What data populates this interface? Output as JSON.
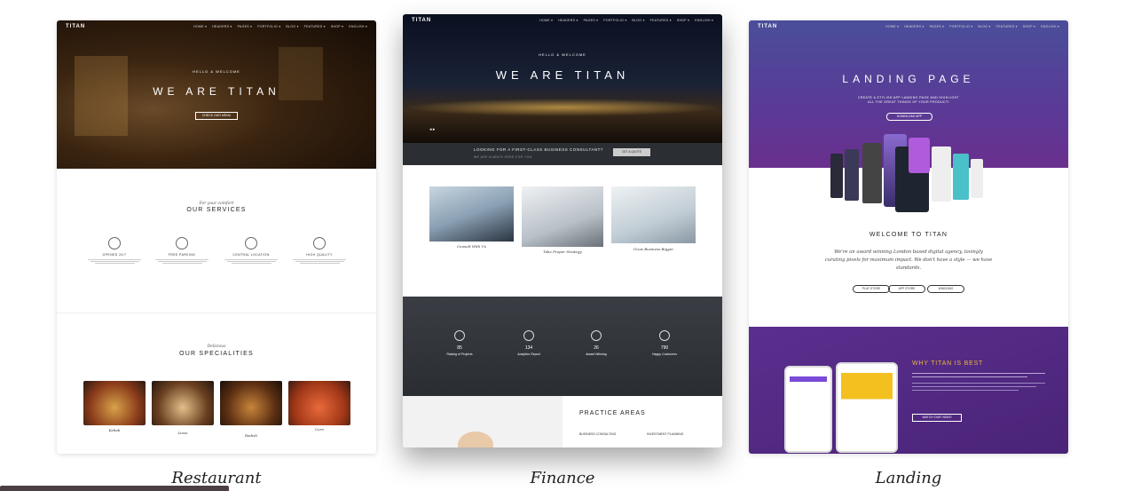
{
  "cards": [
    {
      "caption": "Restaurant",
      "logo": "TITAN",
      "nav": [
        "HOME ▾",
        "HEADERS ▾",
        "PAGES ▾",
        "PORTFOLIO ▾",
        "BLOG ▾",
        "FEATURES ▾",
        "SHOP ▾",
        "ENGLISH ▾"
      ],
      "hero_small": "HELLO & WELCOME",
      "hero_title": "WE ARE TITAN",
      "hero_button": "CHECK OUR MENU",
      "services_sub": "For your comfort",
      "services_title": "OUR SERVICES",
      "services": [
        "OPENED 24/7",
        "FREE PARKING",
        "CENTRAL LOCATION",
        "HIGH QUALITY"
      ],
      "specialities_sub": "Delicious",
      "specialities_title": "OUR SPECIALITIES",
      "dishes": [
        "Kebab",
        "Linos",
        "Radish",
        "Corn"
      ]
    },
    {
      "caption": "Finance",
      "logo": "TITAN",
      "nav": [
        "HOME ▾",
        "HEADERS ▾",
        "PAGES ▾",
        "PORTFOLIO ▾",
        "BLOG ▾",
        "FEATURES ▾",
        "SHOP ▾",
        "ENGLISH ▾"
      ],
      "hero_small": "HELLO & WELCOME",
      "hero_title": "WE ARE TITAN",
      "cta_text": "LOOKING FOR A FIRST-CLASS BUSINESS CONSULTANT?",
      "cta_sub": "WE ARE ALWAYS HERE FOR YOU",
      "cta_button": "GET A QUOTE",
      "features": [
        "Consult With Us",
        "Take Proper Strategy",
        "Grow Business Bigger"
      ],
      "stats": [
        {
          "value": "85",
          "label": "Raising of Projects"
        },
        {
          "value": "134",
          "label": "Analytics Report"
        },
        {
          "value": "26",
          "label": "Award Winning"
        },
        {
          "value": "790",
          "label": "Happy Customers"
        }
      ],
      "practice_title": "PRACTICE AREAS",
      "practice_items": [
        "BUSINESS CONSULTING",
        "INVESTMENT PLANNING"
      ]
    },
    {
      "caption": "Landing",
      "logo": "TITAN",
      "nav": [
        "HOME ▾",
        "HEADERS ▾",
        "PAGES ▾",
        "PORTFOLIO ▾",
        "BLOG ▾",
        "FEATURES ▾",
        "SHOP ▾",
        "ENGLISH ▾"
      ],
      "hero_title": "LANDING PAGE",
      "hero_sub": "CREATE A STYLISH APP LANDING PAGE AND HIGHLIGHT ALL THE GREAT THINGS OF YOUR PRODUCT!",
      "hero_button": "DOWNLOAD APP",
      "welcome_title": "WELCOME TO TITAN",
      "welcome_text": "We're an award winning London based digital agency, lovingly curating pixels for maximum impact. We don't have a style — we have standards.",
      "store_buttons": [
        "PLAY STORE",
        "APP STORE",
        "WINDOWS"
      ],
      "why_title": "WHY TITAN IS BEST",
      "why_button": "WATCH OUR VIDEO"
    }
  ],
  "colors": {
    "landing_purple": "#5a2d8c",
    "accent_gold": "#e8b83c",
    "finance_dark": "#2b2e33"
  }
}
